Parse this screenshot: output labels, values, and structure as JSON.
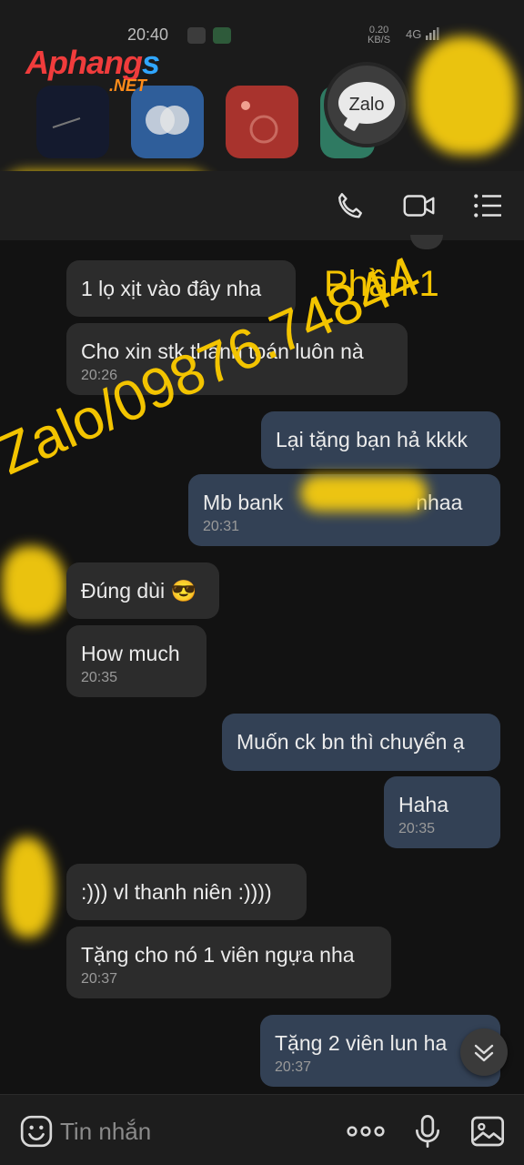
{
  "status_bar": {
    "time": "20:40",
    "speed_value": "0.20",
    "speed_unit": "KB/S",
    "network": "4G"
  },
  "logo": {
    "main_red": "Aphang",
    "main_blue": "s",
    "net": ".NET"
  },
  "app_switcher": {
    "zalo_label": "Zalo"
  },
  "watermark": {
    "text": "Zalo/09876.74844",
    "part": "Phần 1"
  },
  "messages": [
    {
      "dir": "in",
      "text": "1 lọ xịt vào đây nha",
      "time": ""
    },
    {
      "dir": "in",
      "text": "Cho xin stk thanh toán luôn nà",
      "time": "20:26"
    },
    {
      "dir": "out",
      "text": "Lại tặng bạn hả kkkk",
      "time": ""
    },
    {
      "dir": "out",
      "text_left": "Mb bank",
      "text_right": "nhaa",
      "time": "20:31"
    },
    {
      "dir": "in",
      "text": "Đúng dùi 😎",
      "time": ""
    },
    {
      "dir": "in",
      "text": "How much",
      "time": "20:35"
    },
    {
      "dir": "out",
      "text": "Muốn ck bn thì chuyển ạ",
      "time": ""
    },
    {
      "dir": "out",
      "text": "Haha",
      "time": "20:35"
    },
    {
      "dir": "in",
      "text": ":))) vl thanh niên :))))",
      "time": ""
    },
    {
      "dir": "in",
      "text": "Tặng cho nó 1 viên ngựa nha",
      "time": "20:37"
    },
    {
      "dir": "out",
      "text": "Tặng 2 viên lun ha",
      "time": "20:37"
    }
  ],
  "input_bar": {
    "placeholder": "Tin nhắn"
  },
  "icons": {
    "header": [
      "phone-icon",
      "video-call-icon",
      "menu-icon"
    ],
    "input": [
      "emoji-icon",
      "more-icon",
      "microphone-icon",
      "image-icon"
    ],
    "scroll": "chevron-double-down-icon"
  },
  "colors": {
    "background": "#121212",
    "incoming_bubble": "#2c2c2c",
    "outgoing_bubble": "#334155",
    "watermark": "#f3c400",
    "censor": "#f6cc0f"
  }
}
